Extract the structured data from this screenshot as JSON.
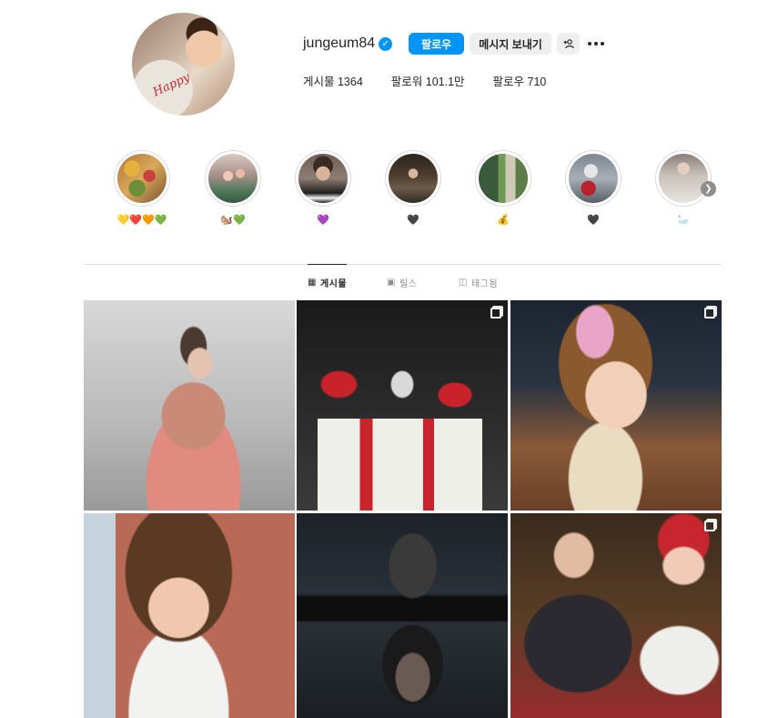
{
  "profile": {
    "username": "jungeum84",
    "verified_mark": "✓",
    "follow_label": "팔로우",
    "message_label": "메시지 보내기",
    "adduser_icon": "add-user-icon",
    "avatar_text": "Happy",
    "stats": {
      "posts": "게시물 1364",
      "followers": "팔로워 101.1만",
      "following": "팔로우 710"
    }
  },
  "highlights": [
    {
      "label": "💛❤️🧡💚"
    },
    {
      "label": "🐿️💚"
    },
    {
      "label": "💜"
    },
    {
      "label": "🖤"
    },
    {
      "label": "💰"
    },
    {
      "label": "🖤"
    },
    {
      "label": "🦢"
    }
  ],
  "tabs": {
    "posts": "게시물",
    "reels": "릴스",
    "tagged": "태그됨"
  },
  "colors": {
    "accent": "#0095f6",
    "button_bg": "#efefef",
    "divider": "#dbdbdb"
  }
}
